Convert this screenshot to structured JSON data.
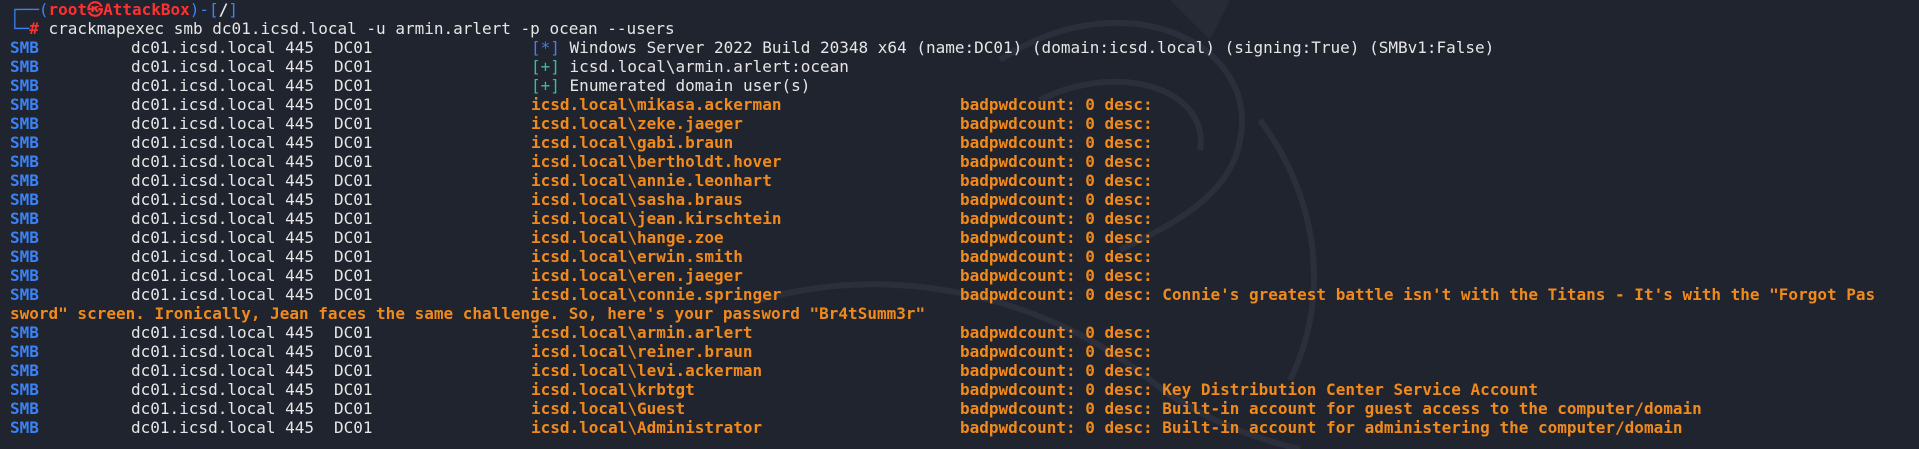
{
  "prompt": {
    "user_host": "root㉿AttackBox",
    "path": "/",
    "command": "crackmapexec smb dc01.icsd.local -u armin.arlert -p ocean --users"
  },
  "info_lines": [
    {
      "proto": "SMB",
      "host": "dc01.icsd.local",
      "port": "445",
      "name": "DC01",
      "tag": "[*]",
      "msg": "Windows Server 2022 Build 20348 x64 (name:DC01) (domain:icsd.local) (signing:True) (SMBv1:False)"
    },
    {
      "proto": "SMB",
      "host": "dc01.icsd.local",
      "port": "445",
      "name": "DC01",
      "tag": "[+]",
      "msg": "icsd.local\\armin.arlert:ocean"
    },
    {
      "proto": "SMB",
      "host": "dc01.icsd.local",
      "port": "445",
      "name": "DC01",
      "tag": "[+]",
      "msg": "Enumerated domain user(s)"
    }
  ],
  "users": [
    {
      "proto": "SMB",
      "host": "dc01.icsd.local",
      "port": "445",
      "name": "DC01",
      "account": "icsd.local\\mikasa.ackerman",
      "badpwd": "badpwdcount: 0 desc:",
      "desc": ""
    },
    {
      "proto": "SMB",
      "host": "dc01.icsd.local",
      "port": "445",
      "name": "DC01",
      "account": "icsd.local\\zeke.jaeger",
      "badpwd": "badpwdcount: 0 desc:",
      "desc": ""
    },
    {
      "proto": "SMB",
      "host": "dc01.icsd.local",
      "port": "445",
      "name": "DC01",
      "account": "icsd.local\\gabi.braun",
      "badpwd": "badpwdcount: 0 desc:",
      "desc": ""
    },
    {
      "proto": "SMB",
      "host": "dc01.icsd.local",
      "port": "445",
      "name": "DC01",
      "account": "icsd.local\\bertholdt.hover",
      "badpwd": "badpwdcount: 0 desc:",
      "desc": ""
    },
    {
      "proto": "SMB",
      "host": "dc01.icsd.local",
      "port": "445",
      "name": "DC01",
      "account": "icsd.local\\annie.leonhart",
      "badpwd": "badpwdcount: 0 desc:",
      "desc": ""
    },
    {
      "proto": "SMB",
      "host": "dc01.icsd.local",
      "port": "445",
      "name": "DC01",
      "account": "icsd.local\\sasha.braus",
      "badpwd": "badpwdcount: 0 desc:",
      "desc": ""
    },
    {
      "proto": "SMB",
      "host": "dc01.icsd.local",
      "port": "445",
      "name": "DC01",
      "account": "icsd.local\\jean.kirschtein",
      "badpwd": "badpwdcount: 0 desc:",
      "desc": ""
    },
    {
      "proto": "SMB",
      "host": "dc01.icsd.local",
      "port": "445",
      "name": "DC01",
      "account": "icsd.local\\hange.zoe",
      "badpwd": "badpwdcount: 0 desc:",
      "desc": ""
    },
    {
      "proto": "SMB",
      "host": "dc01.icsd.local",
      "port": "445",
      "name": "DC01",
      "account": "icsd.local\\erwin.smith",
      "badpwd": "badpwdcount: 0 desc:",
      "desc": ""
    },
    {
      "proto": "SMB",
      "host": "dc01.icsd.local",
      "port": "445",
      "name": "DC01",
      "account": "icsd.local\\eren.jaeger",
      "badpwd": "badpwdcount: 0 desc:",
      "desc": ""
    },
    {
      "proto": "SMB",
      "host": "dc01.icsd.local",
      "port": "445",
      "name": "DC01",
      "account": "icsd.local\\connie.springer",
      "badpwd": "badpwdcount: 0 desc:",
      "desc": "Connie's greatest battle isn't with the Titans - It's with the \"Forgot Pas",
      "wrap": "sword\" screen. Ironically, Jean faces the same challenge. So, here's your password \"Br4tSumm3r\""
    },
    {
      "proto": "SMB",
      "host": "dc01.icsd.local",
      "port": "445",
      "name": "DC01",
      "account": "icsd.local\\armin.arlert",
      "badpwd": "badpwdcount: 0 desc:",
      "desc": ""
    },
    {
      "proto": "SMB",
      "host": "dc01.icsd.local",
      "port": "445",
      "name": "DC01",
      "account": "icsd.local\\reiner.braun",
      "badpwd": "badpwdcount: 0 desc:",
      "desc": ""
    },
    {
      "proto": "SMB",
      "host": "dc01.icsd.local",
      "port": "445",
      "name": "DC01",
      "account": "icsd.local\\levi.ackerman",
      "badpwd": "badpwdcount: 0 desc:",
      "desc": ""
    },
    {
      "proto": "SMB",
      "host": "dc01.icsd.local",
      "port": "445",
      "name": "DC01",
      "account": "icsd.local\\krbtgt",
      "badpwd": "badpwdcount: 0 desc:",
      "desc": "Key Distribution Center Service Account"
    },
    {
      "proto": "SMB",
      "host": "dc01.icsd.local",
      "port": "445",
      "name": "DC01",
      "account": "icsd.local\\Guest",
      "badpwd": "badpwdcount: 0 desc:",
      "desc": "Built-in account for guest access to the computer/domain"
    },
    {
      "proto": "SMB",
      "host": "dc01.icsd.local",
      "port": "445",
      "name": "DC01",
      "account": "icsd.local\\Administrator",
      "badpwd": "badpwdcount: 0 desc:",
      "desc": "Built-in account for administering the computer/domain"
    }
  ],
  "colors": {
    "background": "#20242f",
    "smb": "#3b82f6",
    "user": "#f08a1c",
    "ok": "#3dbb9e",
    "prompt": "#ff3030"
  }
}
